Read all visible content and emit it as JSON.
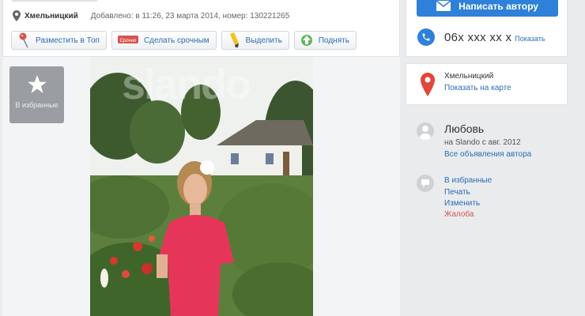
{
  "listing": {
    "city": "Хмельницкий",
    "added": "Добавлено: в 11:26, 23 марта 2014, номер: 130221265"
  },
  "actions": [
    {
      "label": "Разместить в Топ",
      "icon": "pin-top-icon"
    },
    {
      "label": "Сделать срочным",
      "icon": "urgent-tag-icon"
    },
    {
      "label": "Выделить",
      "icon": "highlighter-icon"
    },
    {
      "label": "Поднять",
      "icon": "lift-up-icon"
    }
  ],
  "urgent_tag_text": "Срочно",
  "gallery": {
    "favorite_label": "В избранные",
    "watermark": "slando"
  },
  "contact": {
    "write_button": "Написать автору",
    "phone": "06x xxx xx x",
    "show_label": "Показать"
  },
  "location": {
    "city": "Хмельницкий",
    "map_link": "Показать на карте"
  },
  "author": {
    "name": "Любовь",
    "since": "на Slando с авг. 2012",
    "all_ads": "Все объявления автора"
  },
  "tools": {
    "favorite": "В избранные",
    "print": "Печать",
    "edit": "Изменить",
    "complaint": "Жалоба"
  },
  "colors": {
    "accent": "#2e80d8",
    "link": "#2a6db5",
    "complaint": "#d9534f",
    "map_pin": "#e0463a"
  }
}
